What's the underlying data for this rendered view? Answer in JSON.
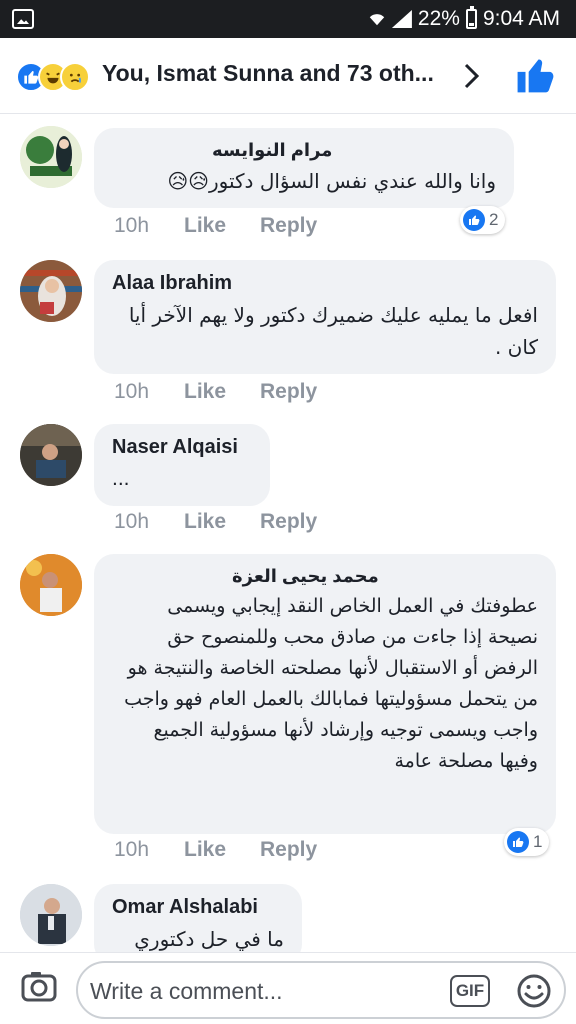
{
  "status_bar": {
    "battery": "22%",
    "time": "9:04 AM",
    "icons": [
      "image-icon",
      "wifi-icon",
      "signal-icon",
      "battery-icon"
    ]
  },
  "header": {
    "title": "You, Ismat Sunna and 73 oth...",
    "reactions": [
      "like-reaction",
      "haha-reaction",
      "sad-reaction"
    ]
  },
  "comments": [
    {
      "author": "مرام النوايسه",
      "text": "وانا والله عندي نفس السؤال دكتور😥😥",
      "time": "10h",
      "like_label": "Like",
      "reply_label": "Reply",
      "reactions_count": "2"
    },
    {
      "author": "Alaa Ibrahim",
      "text": "افعل ما يمليه عليك ضميرك دكتور ولا يهم الآخر أيا كان .",
      "time": "10h",
      "like_label": "Like",
      "reply_label": "Reply"
    },
    {
      "author": "Naser Alqaisi",
      "text": "...",
      "time": "10h",
      "like_label": "Like",
      "reply_label": "Reply"
    },
    {
      "author": "محمد يحيى العزة",
      "text": "عطوفتك في العمل الخاص النقد إيجابي ويسمى نصيحة إذا جاءت من صادق محب وللمنصوح حق الرفض أو الاستقبال لأنها مصلحته الخاصة والنتيجة هو من يتحمل مسؤوليتها فمابالك بالعمل العام فهو واجب واجب ويسمى توجيه وإرشاد لأنها مسؤولية الجميع وفيها مصلحة عامة",
      "time": "10h",
      "like_label": "Like",
      "reply_label": "Reply",
      "reactions_count": "1"
    },
    {
      "author": "Omar Alshalabi",
      "text": "ما في حل دكتوري"
    }
  ],
  "composer": {
    "placeholder": "Write a comment...",
    "gif_label": "GIF"
  },
  "colors": {
    "status_bar": "#1c1e21",
    "facebook_blue": "#1877f2",
    "bubble": "#f0f2f5",
    "meta_gray": "#8d949e"
  }
}
